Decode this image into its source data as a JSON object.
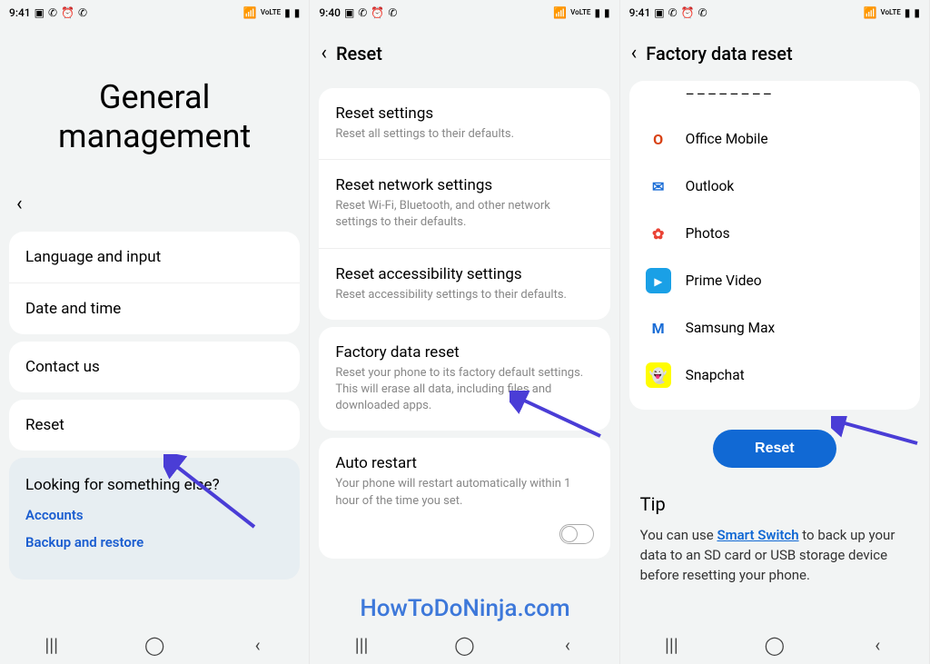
{
  "status_bar": {
    "time1": "9:41",
    "time2": "9:40",
    "time3": "9:41",
    "icons_left": [
      "image-icon",
      "whatsapp-icon",
      "alarm-icon",
      "whatsapp-icon"
    ],
    "icons_right": [
      "wifi-icon",
      "volte-icon",
      "signal-icon",
      "battery-icon"
    ]
  },
  "screen1": {
    "title": "General management",
    "items": [
      {
        "label": "Language and input"
      },
      {
        "label": "Date and time"
      },
      {
        "label": "Contact us"
      },
      {
        "label": "Reset"
      }
    ],
    "looking_title": "Looking for something else?",
    "looking_links": [
      "Accounts",
      "Backup and restore"
    ]
  },
  "screen2": {
    "title": "Reset",
    "items": [
      {
        "label": "Reset settings",
        "sub": "Reset all settings to their defaults."
      },
      {
        "label": "Reset network settings",
        "sub": "Reset Wi-Fi, Bluetooth, and other network settings to their defaults."
      },
      {
        "label": "Reset accessibility settings",
        "sub": "Reset accessibility settings to their defaults."
      },
      {
        "label": "Factory data reset",
        "sub": "Reset your phone to its factory default settings. This will erase all data, including files and downloaded apps."
      },
      {
        "label": "Auto restart",
        "sub": "Your phone will restart automatically within 1 hour of the time you set."
      }
    ]
  },
  "screen3": {
    "title": "Factory data reset",
    "apps": [
      {
        "name": "Office Mobile",
        "bg": "#ffffff",
        "fg": "#d84215",
        "glyph": "O"
      },
      {
        "name": "Outlook",
        "bg": "#ffffff",
        "fg": "#1a6dd6",
        "glyph": "✉"
      },
      {
        "name": "Photos",
        "bg": "#ffffff",
        "fg": "#ea4335",
        "glyph": "✿"
      },
      {
        "name": "Prime Video",
        "bg": "#1aa0e6",
        "fg": "#ffffff",
        "glyph": "▸"
      },
      {
        "name": "Samsung Max",
        "bg": "#ffffff",
        "fg": "#1a6dd6",
        "glyph": "M"
      },
      {
        "name": "Snapchat",
        "bg": "#fffc00",
        "fg": "#ffffff",
        "glyph": "👻"
      }
    ],
    "reset_button": "Reset",
    "tip_title": "Tip",
    "tip_text_before": "You can use ",
    "tip_link": "Smart Switch",
    "tip_text_after": " to back up your data to an SD card or USB storage device before resetting your phone."
  },
  "watermark": "HowToDoNinja.com"
}
